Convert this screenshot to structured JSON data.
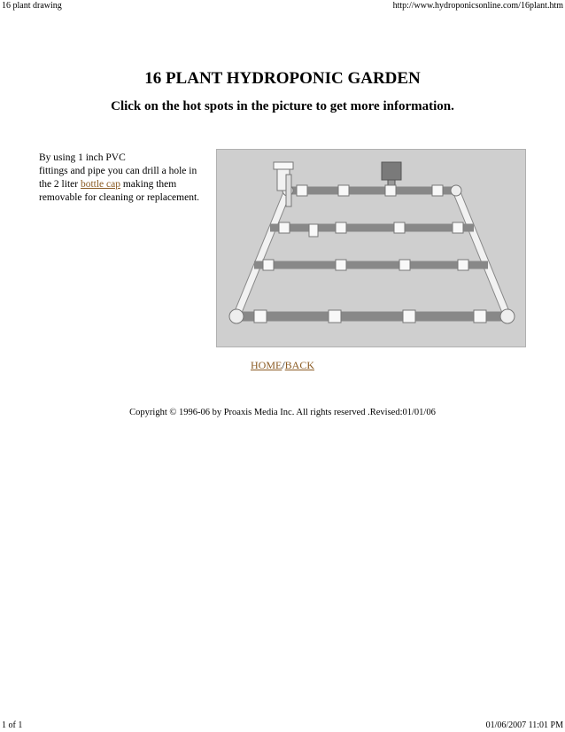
{
  "print_header": {
    "title": "16 plant drawing",
    "url": "http://www.hydroponicsonline.com/16plant.htm"
  },
  "page": {
    "heading": "16 PLANT HYDROPONIC GARDEN",
    "subheading": "Click on the hot spots in the picture to get more information."
  },
  "intro": {
    "line1": "By using 1 inch PVC",
    "line2": "fittings and pipe you can drill a hole in",
    "line3_before": "the 2 liter ",
    "link": "bottle cap",
    "line3_after": " making them",
    "line4": "removable for cleaning or replacement."
  },
  "nav": {
    "home": "HOME",
    "separator": "/",
    "back": "BACK"
  },
  "copyright": "Copyright © 1996-06  by Proaxis Media Inc. All rights reserved .Revised:01/01/06",
  "print_footer": {
    "pages": "1 of 1",
    "timestamp": "01/06/2007 11:01 PM"
  },
  "colors": {
    "link": "#8a5a22",
    "photo_background": "#cfcfcf",
    "pipe": "#f2f2f2"
  }
}
